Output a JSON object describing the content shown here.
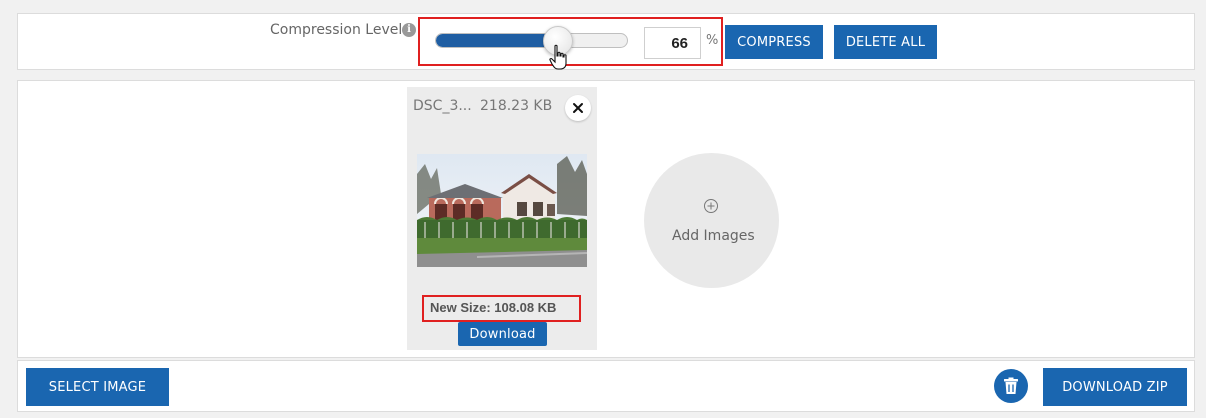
{
  "toolbar": {
    "compression_label": "Compression Level",
    "info_glyph": "i",
    "slider_fraction": 0.66,
    "percent_value": "66",
    "percent_sign": "%",
    "compress_label": "COMPRESS",
    "delete_all_label": "DELETE ALL"
  },
  "image_card": {
    "filename": "DSC_3...",
    "original_size": "218.23 KB",
    "new_size": "New Size: 108.08 KB",
    "download_label": "Download"
  },
  "add_images": {
    "label": "Add Images"
  },
  "footer": {
    "select_image_label": "SELECT IMAGE",
    "download_zip_label": "DOWNLOAD ZIP"
  },
  "icons": {
    "info": "info-icon",
    "close": "close-icon",
    "add": "plus-circle-icon",
    "trash": "trash-icon",
    "cursor": "hand-cursor-icon"
  },
  "colors": {
    "primary_button": "#1a66b0",
    "slider_fill": "#1f5ea3",
    "highlight": "#e02020"
  }
}
